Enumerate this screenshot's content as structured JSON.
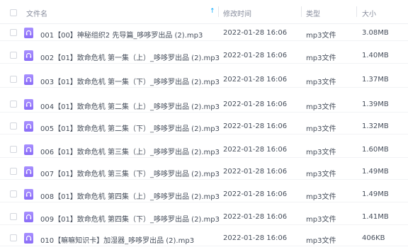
{
  "header": {
    "name": "文件名",
    "modified": "修改时间",
    "type": "类型",
    "size": "大小",
    "sort_icon": "sort-arrow-up-icon"
  },
  "files": [
    {
      "name": "001【00】神秘组织2 先导篇_哆哆罗出品 (2).mp3",
      "date": "2022-01-28 16:06",
      "type": "mp3文件",
      "size": "3.08MB"
    },
    {
      "name": "002【01】致命危机 第一集（上）_哆哆罗出品 (2).mp3",
      "date": "2022-01-28 16:06",
      "type": "mp3文件",
      "size": "1.40MB"
    },
    {
      "name": "003【01】致命危机 第一集（下）_哆哆罗出品 (2).mp3",
      "date": "2022-01-28 16:06",
      "type": "mp3文件",
      "size": "1.37MB"
    },
    {
      "name": "004【01】致命危机 第二集（上）_哆哆罗出品 (2).mp3",
      "date": "2022-01-28 16:06",
      "type": "mp3文件",
      "size": "1.39MB"
    },
    {
      "name": "005【01】致命危机 第二集（下）_哆哆罗出品 (2).mp3",
      "date": "2022-01-28 16:06",
      "type": "mp3文件",
      "size": "1.32MB"
    },
    {
      "name": "006【01】致命危机 第三集（上）_哆哆罗出品 (2).mp3",
      "date": "2022-01-28 16:06",
      "type": "mp3文件",
      "size": "1.60MB"
    },
    {
      "name": "007【01】致命危机 第三集（下）_哆哆罗出品 (2).mp3",
      "date": "2022-01-28 16:06",
      "type": "mp3文件",
      "size": "1.49MB"
    },
    {
      "name": "008【01】致命危机 第四集（上）_哆哆罗出品 (2).mp3",
      "date": "2022-01-28 16:06",
      "type": "mp3文件",
      "size": "1.49MB"
    },
    {
      "name": "009【01】致命危机 第四集（下）_哆哆罗出品 (2).mp3",
      "date": "2022-01-28 16:06",
      "type": "mp3文件",
      "size": "1.41MB"
    },
    {
      "name": "010【嘛嘛知识卡】加湿器_哆哆罗出品 (2).mp3",
      "date": "2022-01-28 16:06",
      "type": "mp3文件",
      "size": "406KB"
    }
  ]
}
